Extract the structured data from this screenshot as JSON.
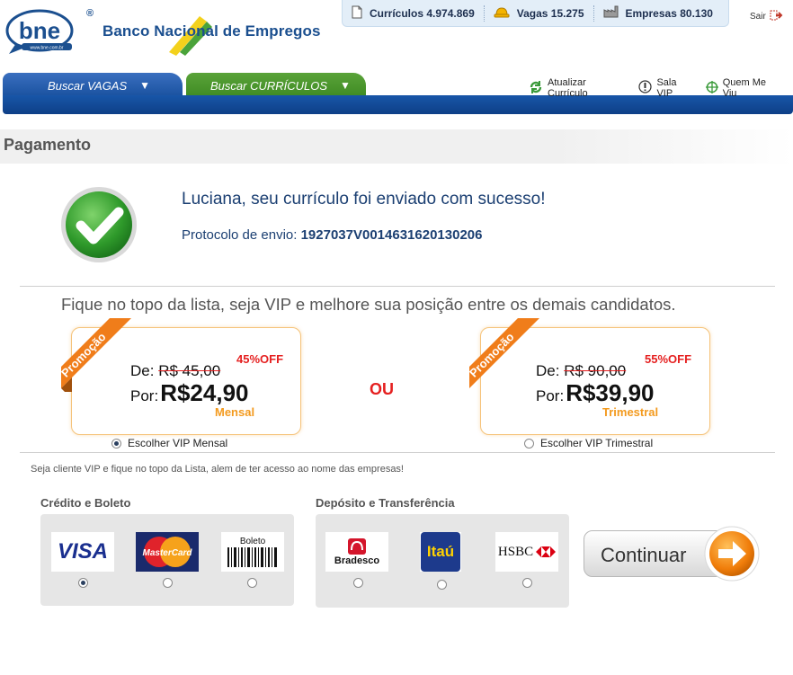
{
  "header": {
    "brand_name": "Banco Nacional de Empregos",
    "logo_text": "bne",
    "logo_url_text": "www.bne.com.br",
    "registered_mark": "®",
    "stats": [
      {
        "label": "Currículos",
        "value": "4.974.869",
        "icon": "document-icon"
      },
      {
        "label": "Vagas",
        "value": "15.275",
        "icon": "hard-hat-icon"
      },
      {
        "label": "Empresas",
        "value": "80.130",
        "icon": "factory-icon"
      }
    ],
    "logout_label": "Sair"
  },
  "nav": {
    "tab_vagas": "Buscar VAGAS",
    "tab_curriculos": "Buscar CURRÍCULOS",
    "tab_arrow": "▼",
    "links": [
      {
        "label": "Atualizar Currículo",
        "icon": "refresh-icon"
      },
      {
        "label": "Sala VIP",
        "icon": "vip-icon"
      },
      {
        "label": "Quem Me Viu",
        "icon": "target-icon"
      }
    ]
  },
  "page": {
    "title": "Pagamento",
    "success_message": "Luciana, seu currículo foi enviado com sucesso!",
    "protocol_label": "Protocolo de envio:",
    "protocol_number": "1927037V0014631620130206",
    "vip_headline": "Fique no topo da lista, seja VIP e melhore sua posição entre os demais candidatos.",
    "or_label": "OU",
    "vip_note": "Seja cliente VIP e fique no topo da Lista, alem de ter acesso ao nome das empresas!"
  },
  "plans": [
    {
      "ribbon": "Promoção",
      "discount": "45%OFF",
      "from_label": "De:",
      "from_price": "R$ 45,00",
      "to_label": "Por:",
      "to_price": "R$24,90",
      "period": "Mensal",
      "choice_label": "Escolher VIP Mensal",
      "selected": true
    },
    {
      "ribbon": "Promoção",
      "discount": "55%OFF",
      "from_label": "De:",
      "from_price": "R$ 90,00",
      "to_label": "Por:",
      "to_price": "R$39,90",
      "period": "Trimestral",
      "choice_label": "Escolher VIP Trimestral",
      "selected": false
    }
  ],
  "payment": {
    "credit_title": "Crédito e Boleto",
    "deposit_title": "Depósito e Transferência",
    "credit_methods": [
      {
        "name": "VISA",
        "selected": true
      },
      {
        "name": "MasterCard",
        "selected": false
      },
      {
        "name": "Boleto",
        "selected": false
      }
    ],
    "deposit_methods": [
      {
        "name": "Bradesco",
        "selected": false
      },
      {
        "name": "Itaú",
        "selected": false
      },
      {
        "name": "HSBC",
        "selected": false
      }
    ],
    "continue_label": "Continuar"
  },
  "colors": {
    "brand_blue": "#1b4f8f",
    "tab_blue": "#18509e",
    "tab_green": "#3d8a22",
    "offer_red": "#e52020",
    "period_orange": "#f39a1e"
  }
}
